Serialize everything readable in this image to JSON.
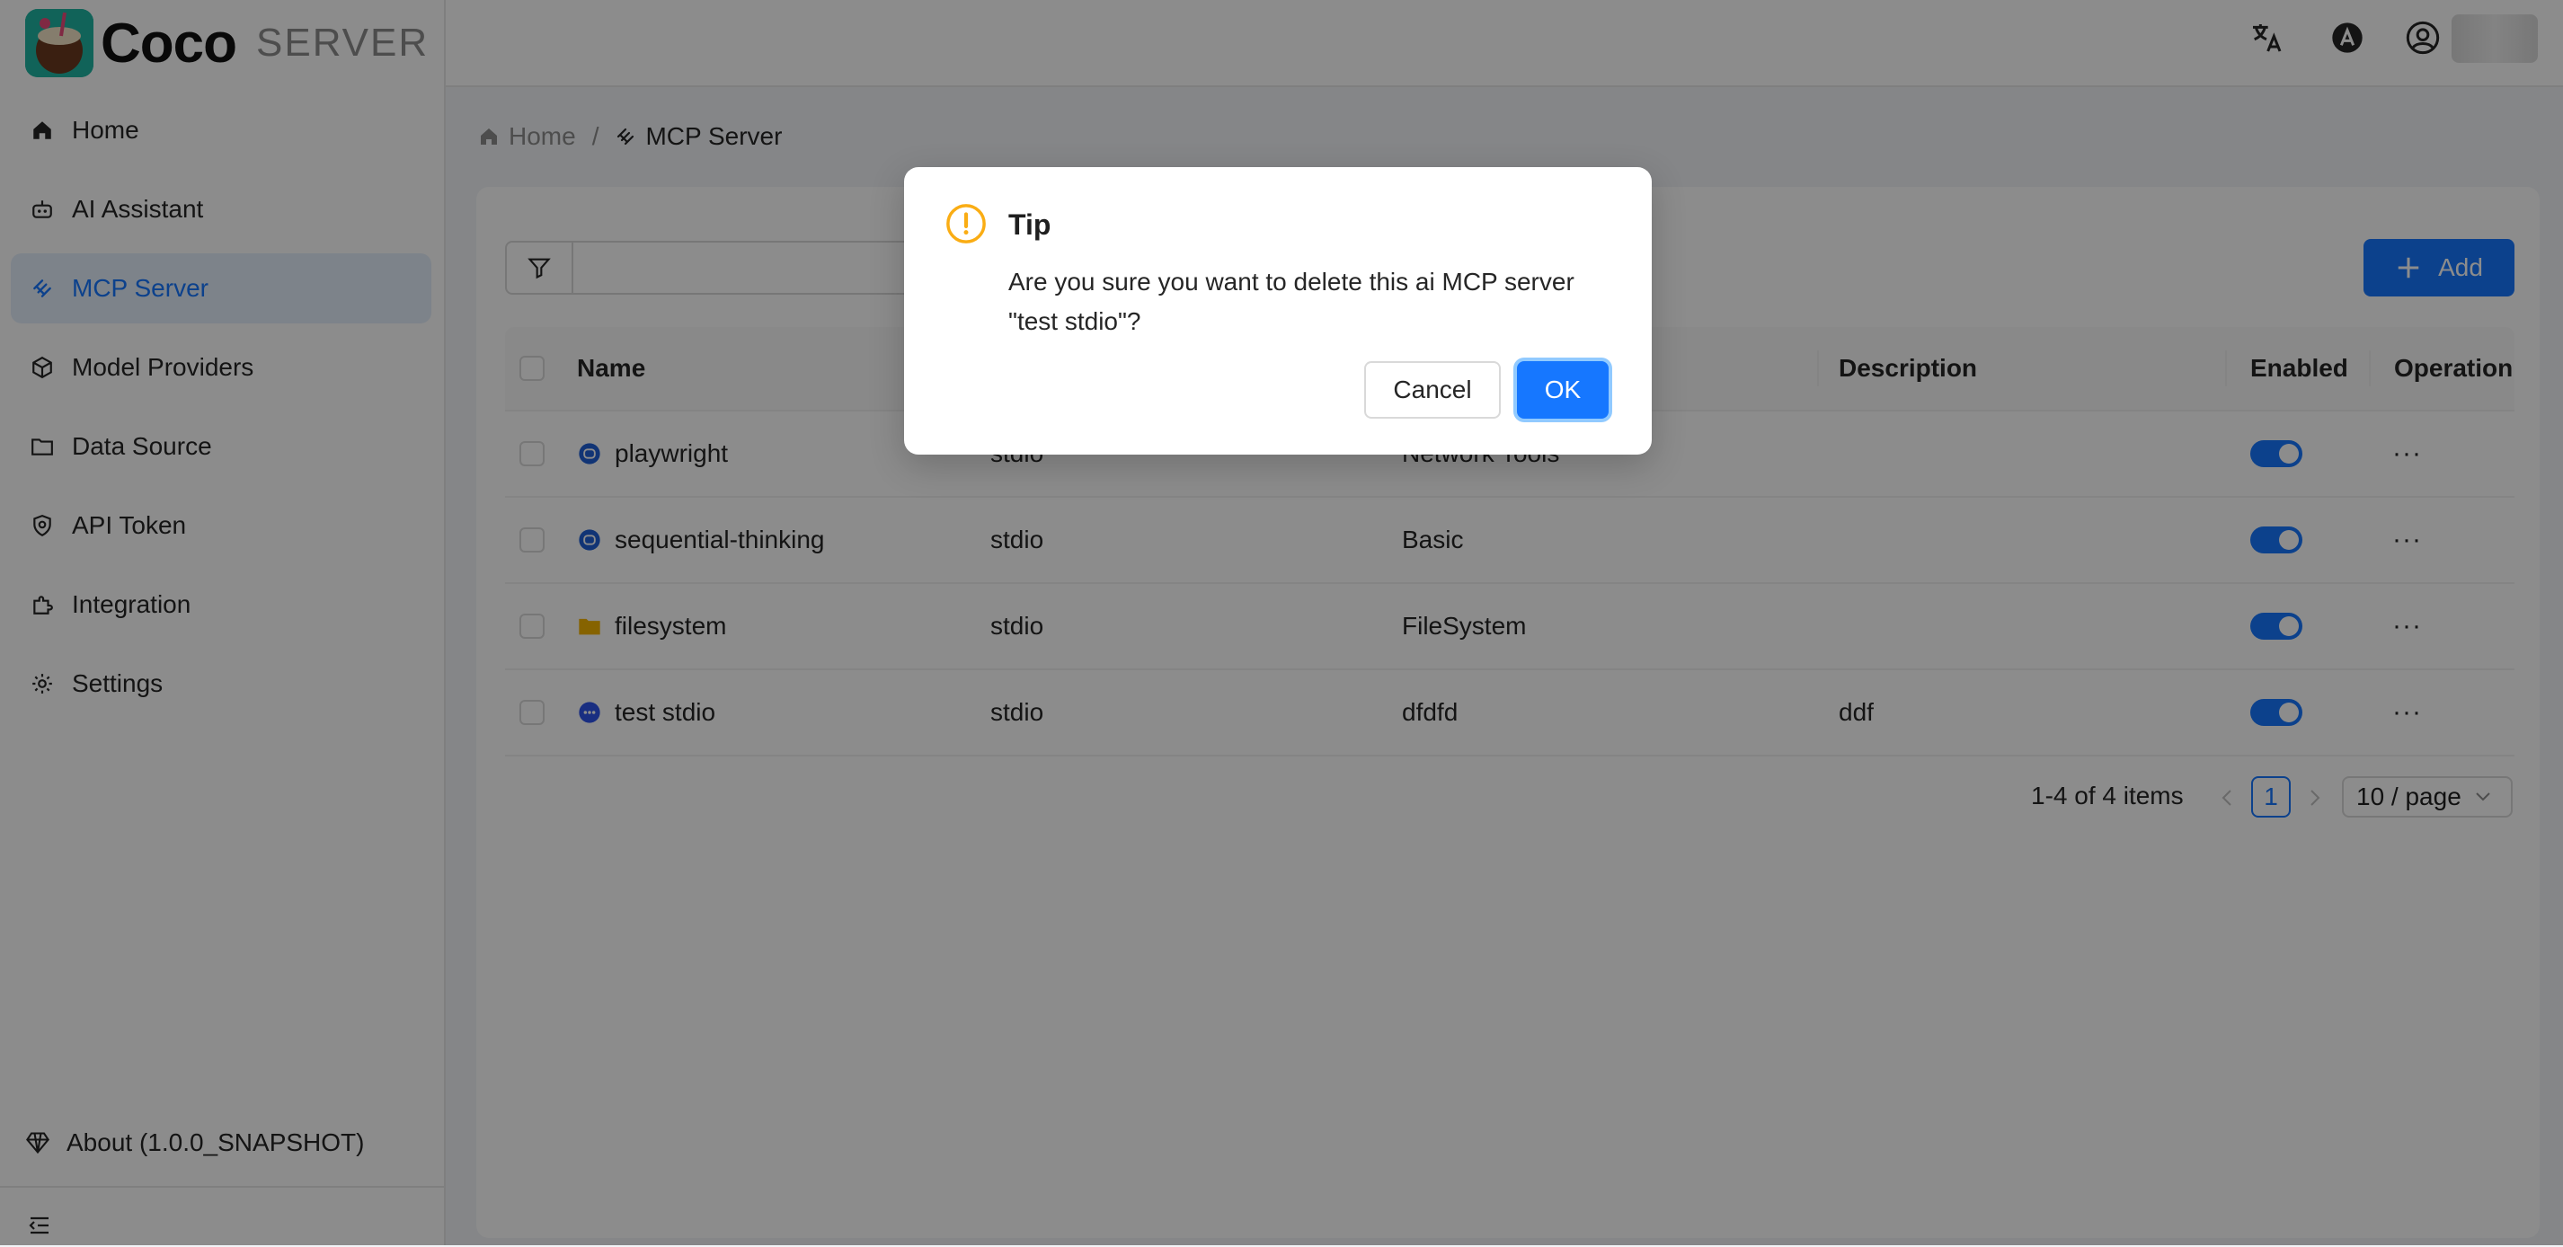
{
  "brand": {
    "name": "Coco",
    "sub": "SERVER"
  },
  "sidebar": {
    "items": [
      {
        "label": "Home",
        "icon": "home-icon"
      },
      {
        "label": "AI Assistant",
        "icon": "robot-icon"
      },
      {
        "label": "MCP Server",
        "icon": "mcp-icon",
        "active": true
      },
      {
        "label": "Model Providers",
        "icon": "cube-icon"
      },
      {
        "label": "Data Source",
        "icon": "folder-icon"
      },
      {
        "label": "API Token",
        "icon": "shield-icon"
      },
      {
        "label": "Integration",
        "icon": "puzzle-icon"
      },
      {
        "label": "Settings",
        "icon": "gear-icon"
      }
    ],
    "about": "About (1.0.0_SNAPSHOT)"
  },
  "breadcrumb": {
    "home": "Home",
    "current": "MCP Server"
  },
  "toolbar": {
    "add_label": "Add",
    "search_value": ""
  },
  "table": {
    "columns": {
      "name": "Name",
      "description": "Description",
      "enabled": "Enabled",
      "operation": "Operation"
    },
    "rows": [
      {
        "name": "playwright",
        "type": "stdio",
        "category": "Network Tools",
        "description": "",
        "enabled": true,
        "icon": "mcp-bubble-icon"
      },
      {
        "name": "sequential-thinking",
        "type": "stdio",
        "category": "Basic",
        "description": "",
        "enabled": true,
        "icon": "mcp-bubble-icon"
      },
      {
        "name": "filesystem",
        "type": "stdio",
        "category": "FileSystem",
        "description": "",
        "enabled": true,
        "icon": "folder-icon"
      },
      {
        "name": "test stdio",
        "type": "stdio",
        "category": "dfdfd",
        "description": "ddf",
        "enabled": true,
        "icon": "chat-icon"
      }
    ],
    "operation_symbol": "···"
  },
  "pagination": {
    "total_text": "1-4 of 4 items",
    "current_page": "1",
    "page_size": "10 / page"
  },
  "modal": {
    "title": "Tip",
    "message": "Are you sure you want to delete this ai MCP server \"test stdio\"?",
    "cancel_label": "Cancel",
    "ok_label": "OK"
  },
  "colors": {
    "primary": "#1677ff",
    "warning": "#faad14",
    "folder": "#f5b400"
  }
}
